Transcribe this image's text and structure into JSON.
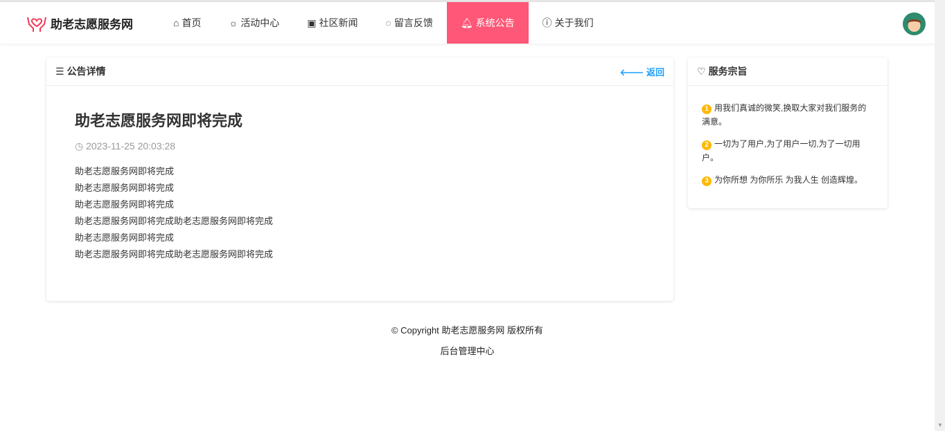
{
  "brand": {
    "title": "助老志愿服务网"
  },
  "nav": [
    {
      "label": "首页",
      "icon": "home-icon"
    },
    {
      "label": "活动中心",
      "icon": "sun-icon"
    },
    {
      "label": "社区新闻",
      "icon": "news-icon"
    },
    {
      "label": "留言反馈",
      "icon": "chat-icon"
    },
    {
      "label": "系统公告",
      "icon": "bell-icon",
      "active": true
    },
    {
      "label": "关于我们",
      "icon": "info-icon"
    }
  ],
  "main": {
    "header": "公告详情",
    "back": "返回",
    "title": "助老志愿服务网即将完成",
    "date": "2023-11-25 20:03:28",
    "lines": [
      "助老志愿服务网即将完成",
      "助老志愿服务网即将完成",
      "助老志愿服务网即将完成",
      "助老志愿服务网即将完成助老志愿服务网即将完成",
      "助老志愿服务网即将完成",
      "助老志愿服务网即将完成助老志愿服务网即将完成"
    ]
  },
  "side": {
    "header": "服务宗旨",
    "items": [
      {
        "num": "1",
        "text": "用我们真诚的微笑,换取大家对我们服务的满意。"
      },
      {
        "num": "2",
        "text": "一切为了用户,为了用户一切,为了一切用户。"
      },
      {
        "num": "3",
        "text": "为你所想 为你所乐 为我人生 创造辉煌。"
      }
    ]
  },
  "footer": {
    "copyright": "© Copyright 助老志愿服务网 版权所有",
    "admin": "后台管理中心"
  },
  "colors": {
    "accent": "#ff5777",
    "link": "#1e9fff",
    "badge": "#ffb800"
  }
}
